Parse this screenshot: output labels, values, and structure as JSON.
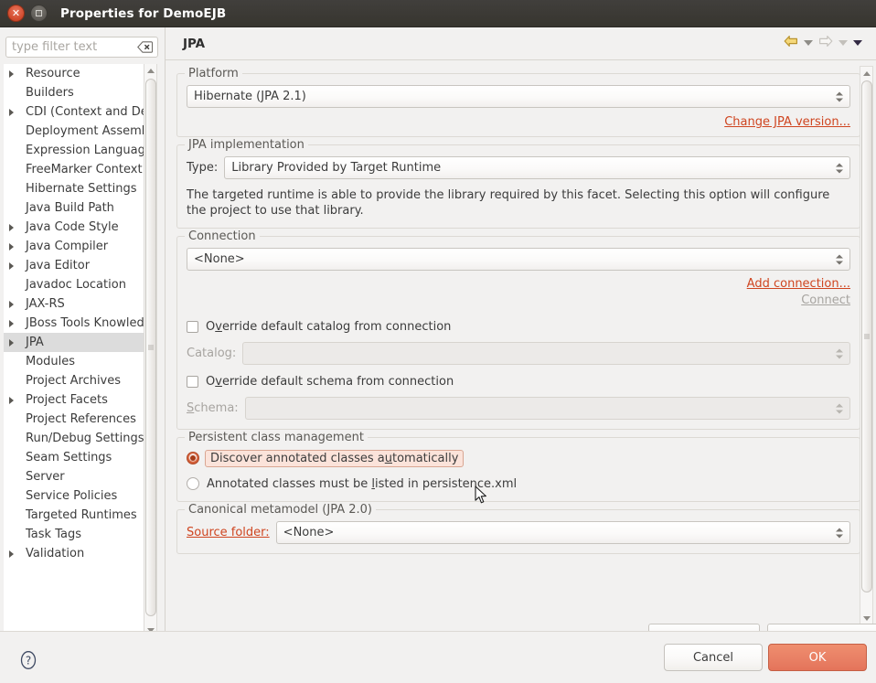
{
  "window": {
    "title": "Properties for DemoEJB",
    "close_icon": "close-icon",
    "maximize_icon": "maximize-icon"
  },
  "sidebar": {
    "filter": {
      "placeholder": "type filter text",
      "value": "",
      "clear_icon": "clear-filter-icon"
    },
    "items": [
      {
        "label": "Resource",
        "expandable": true,
        "selected": false
      },
      {
        "label": "Builders",
        "expandable": false,
        "selected": false
      },
      {
        "label": "CDI (Context and De",
        "expandable": true,
        "selected": false
      },
      {
        "label": "Deployment Assembl",
        "expandable": false,
        "selected": false
      },
      {
        "label": "Expression Languag",
        "expandable": false,
        "selected": false
      },
      {
        "label": "FreeMarker Context",
        "expandable": false,
        "selected": false
      },
      {
        "label": "Hibernate Settings",
        "expandable": false,
        "selected": false
      },
      {
        "label": "Java Build Path",
        "expandable": false,
        "selected": false
      },
      {
        "label": "Java Code Style",
        "expandable": true,
        "selected": false
      },
      {
        "label": "Java Compiler",
        "expandable": true,
        "selected": false
      },
      {
        "label": "Java Editor",
        "expandable": true,
        "selected": false
      },
      {
        "label": "Javadoc Location",
        "expandable": false,
        "selected": false
      },
      {
        "label": "JAX-RS",
        "expandable": true,
        "selected": false
      },
      {
        "label": "JBoss Tools Knowled",
        "expandable": true,
        "selected": false
      },
      {
        "label": "JPA",
        "expandable": true,
        "selected": true
      },
      {
        "label": "Modules",
        "expandable": false,
        "selected": false
      },
      {
        "label": "Project Archives",
        "expandable": false,
        "selected": false
      },
      {
        "label": "Project Facets",
        "expandable": true,
        "selected": false
      },
      {
        "label": "Project References",
        "expandable": false,
        "selected": false
      },
      {
        "label": "Run/Debug Settings",
        "expandable": false,
        "selected": false
      },
      {
        "label": "Seam Settings",
        "expandable": false,
        "selected": false
      },
      {
        "label": "Server",
        "expandable": false,
        "selected": false
      },
      {
        "label": "Service Policies",
        "expandable": false,
        "selected": false
      },
      {
        "label": "Targeted Runtimes",
        "expandable": false,
        "selected": false
      },
      {
        "label": "Task Tags",
        "expandable": false,
        "selected": false
      },
      {
        "label": "Validation",
        "expandable": true,
        "selected": false
      }
    ]
  },
  "page": {
    "title": "JPA",
    "nav": {
      "back_icon": "back-arrow-icon",
      "back_menu_icon": "chevron-down-icon",
      "forward_icon": "forward-arrow-icon",
      "forward_menu_icon": "chevron-down-icon",
      "menu_icon": "chevron-down-icon"
    },
    "platform": {
      "legend": "Platform",
      "value": "Hibernate (JPA 2.1)",
      "change_link": "Change JPA version..."
    },
    "implementation": {
      "legend": "JPA implementation",
      "type_label": "Type:",
      "type_value": "Library Provided by Target Runtime",
      "description": "The targeted runtime is able to provide the library required by this facet. Selecting this option will configure the project to use that library."
    },
    "connection": {
      "legend": "Connection",
      "value": "<None>",
      "add_link": "Add connection...",
      "connect_link": "Connect",
      "override_catalog_label": "Override default catalog from connection",
      "override_catalog_checked": false,
      "catalog_label": "Catalog:",
      "catalog_value": "",
      "override_schema_label": "Override default schema from connection",
      "override_schema_checked": false,
      "schema_label": "Schema:",
      "schema_value": ""
    },
    "persistent_class_management": {
      "legend": "Persistent class management",
      "option_discover": "Discover annotated classes automatically",
      "option_listed": "Annotated classes must be listed in persistence.xml",
      "selected": "discover"
    },
    "canonical_metamodel": {
      "legend": "Canonical metamodel (JPA 2.0)",
      "source_folder_label": "Source folder:",
      "source_folder_value": "<None>"
    }
  },
  "footer": {
    "help_icon": "help-icon",
    "cancel_label": "Cancel",
    "ok_label": "OK"
  },
  "colors": {
    "accent_link": "#cf4520",
    "ok_button": "#e98065",
    "selection": "#dcdcdc",
    "focus_highlight": "#fbe3da"
  }
}
